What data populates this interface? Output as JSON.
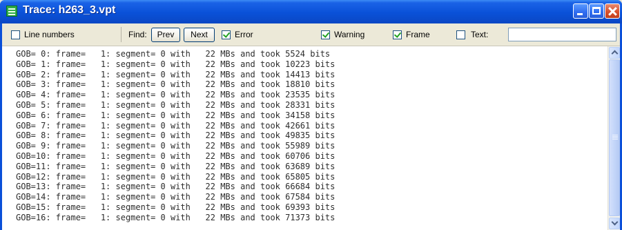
{
  "window": {
    "title": "Trace: h263_3.vpt"
  },
  "toolbar": {
    "line_numbers": {
      "label": "Line numbers",
      "checked": false
    },
    "find_label": "Find:",
    "prev_label": "Prev",
    "next_label": "Next",
    "error": {
      "label": "Error",
      "checked": true
    },
    "warning": {
      "label": "Warning",
      "checked": true
    },
    "frame": {
      "label": "Frame",
      "checked": true
    },
    "text": {
      "label": "Text:",
      "checked": false,
      "value": ""
    }
  },
  "trace": {
    "lines": [
      "GOB= 0: frame=   1: segment= 0 with   22 MBs and took 5524 bits",
      "GOB= 1: frame=   1: segment= 0 with   22 MBs and took 10223 bits",
      "GOB= 2: frame=   1: segment= 0 with   22 MBs and took 14413 bits",
      "GOB= 3: frame=   1: segment= 0 with   22 MBs and took 18810 bits",
      "GOB= 4: frame=   1: segment= 0 with   22 MBs and took 23535 bits",
      "GOB= 5: frame=   1: segment= 0 with   22 MBs and took 28331 bits",
      "GOB= 6: frame=   1: segment= 0 with   22 MBs and took 34158 bits",
      "GOB= 7: frame=   1: segment= 0 with   22 MBs and took 42661 bits",
      "GOB= 8: frame=   1: segment= 0 with   22 MBs and took 49835 bits",
      "GOB= 9: frame=   1: segment= 0 with   22 MBs and took 55989 bits",
      "GOB=10: frame=   1: segment= 0 with   22 MBs and took 60706 bits",
      "GOB=11: frame=   1: segment= 0 with   22 MBs and took 63689 bits",
      "GOB=12: frame=   1: segment= 0 with   22 MBs and took 65805 bits",
      "GOB=13: frame=   1: segment= 0 with   22 MBs and took 66684 bits",
      "GOB=14: frame=   1: segment= 0 with   22 MBs and took 67584 bits",
      "GOB=15: frame=   1: segment= 0 with   22 MBs and took 69393 bits",
      "GOB=16: frame=   1: segment= 0 with   22 MBs and took 71373 bits"
    ]
  },
  "icons": {
    "app": "trace-app-icon",
    "minimize": "minimize-icon",
    "maximize": "maximize-icon",
    "close": "close-icon",
    "scroll_up": "scroll-up-icon",
    "scroll_down": "scroll-down-icon"
  }
}
